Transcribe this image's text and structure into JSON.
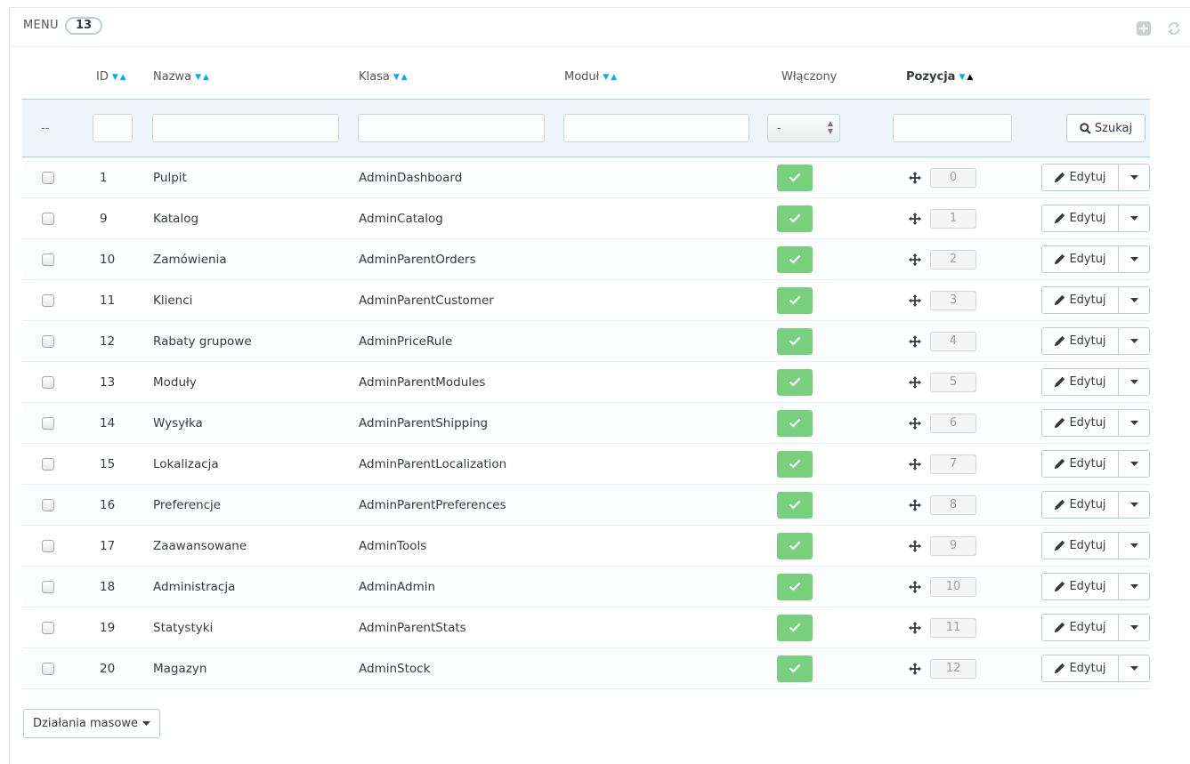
{
  "panel": {
    "title": "MENU",
    "count": "13"
  },
  "toolbar": {
    "icons": [
      "add-icon",
      "refresh-icon"
    ]
  },
  "columns": {
    "id": "ID",
    "name": "Nazwa",
    "class": "Klasa",
    "module": "Moduł",
    "enabled": "Włączony",
    "position": "Pozycja"
  },
  "filters": {
    "reset_placeholder": "--",
    "enabled_select_value": "-",
    "search_label": "Szukaj"
  },
  "rows": [
    {
      "id": "1",
      "name": "Pulpit",
      "class": "AdminDashboard",
      "module": "",
      "position": "0"
    },
    {
      "id": "9",
      "name": "Katalog",
      "class": "AdminCatalog",
      "module": "",
      "position": "1"
    },
    {
      "id": "10",
      "name": "Zamówienia",
      "class": "AdminParentOrders",
      "module": "",
      "position": "2"
    },
    {
      "id": "11",
      "name": "Klienci",
      "class": "AdminParentCustomer",
      "module": "",
      "position": "3"
    },
    {
      "id": "12",
      "name": "Rabaty grupowe",
      "class": "AdminPriceRule",
      "module": "",
      "position": "4"
    },
    {
      "id": "13",
      "name": "Moduły",
      "class": "AdminParentModules",
      "module": "",
      "position": "5"
    },
    {
      "id": "14",
      "name": "Wysyłka",
      "class": "AdminParentShipping",
      "module": "",
      "position": "6"
    },
    {
      "id": "15",
      "name": "Lokalizacja",
      "class": "AdminParentLocalization",
      "module": "",
      "position": "7"
    },
    {
      "id": "16",
      "name": "Preferencje",
      "class": "AdminParentPreferences",
      "module": "",
      "position": "8"
    },
    {
      "id": "17",
      "name": "Zaawansowane",
      "class": "AdminTools",
      "module": "",
      "position": "9"
    },
    {
      "id": "18",
      "name": "Administracja",
      "class": "AdminAdmin",
      "module": "",
      "position": "10"
    },
    {
      "id": "19",
      "name": "Statystyki",
      "class": "AdminParentStats",
      "module": "",
      "position": "11"
    },
    {
      "id": "20",
      "name": "Magazyn",
      "class": "AdminStock",
      "module": "",
      "position": "12"
    }
  ],
  "row_actions": {
    "edit_label": "Edytuj"
  },
  "bulk": {
    "label": "Działania masowe"
  },
  "colors": {
    "enabled_green": "#78d07d",
    "sort_arrow": "#00aff0",
    "filter_bg": "#eff6fb"
  }
}
